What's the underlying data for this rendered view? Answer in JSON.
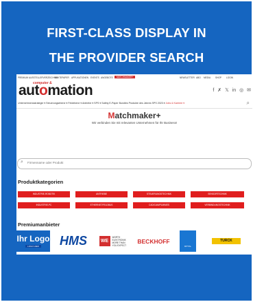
{
  "banner": {
    "headline_line1": "FIRST-CLASS DISPLAY IN",
    "headline_line2": "THE PROVIDER SEARCH",
    "background_color": "#1565c0",
    "text_color": "#ffffff"
  },
  "screenshot": {
    "top_nav": {
      "items": [
        "PREMIUM",
        "AUSSTELLERVERZEICHNIS",
        "WHITEPAPER",
        "APPLIKATIONEN",
        "EVENTS",
        "ANGEBOTE"
      ],
      "highlight_tag": "MATCHMAKER+",
      "right_items": [
        "NEWSLETTER",
        "ABO",
        "MEDIA",
        "SHOP",
        "LOGIN"
      ]
    },
    "logo": {
      "prefix": "computer &",
      "name_part1": "aut",
      "name_accent": "o",
      "name_part2": "mation"
    },
    "social_icons": [
      "facebook-icon",
      "xing-icon",
      "x-icon",
      "linkedin-icon",
      "instagram-icon",
      "mail-icon"
    ],
    "social_glyphs": [
      "f",
      "✗",
      "𝕏",
      "in",
      "◎",
      "✉"
    ],
    "category_nav": {
      "items": [
        "Unternehmensstrategie ▾",
        "Steuerungsebene ▾",
        "Feldebene ▾",
        "Antriebe ▾",
        "SPS ▾",
        "Safety",
        "E-Paper",
        "Bundles",
        "Produkte des Jahres",
        "SPS 2023 ▾"
      ],
      "red_item": "Jobs & Karriere ▾"
    },
    "matchmaker": {
      "title_first": "M",
      "title_rest": "atchmaker+",
      "subtitle": "Wir verbinden Sie mit relevanten Unternehmen für Ihr Business!"
    },
    "search": {
      "placeholder": "Firmenname oder Produkt"
    },
    "categories": {
      "heading": "Produktkategorien",
      "items": [
        "INDUSTRIE-ROBOTIK",
        "ANTRIEBE",
        "STEUERUNGSTECHNIK",
        "SENSORTECHNIK",
        "INDUSTRIE-PC",
        "ETHERNET/FELDBUS",
        "CAD/CAM/PLM/MES",
        "VERBINDUNGSTECHNIK"
      ],
      "color": "#e01e1e"
    },
    "premium": {
      "heading": "Premiumanbieter",
      "ihr_logo": "Ihr Logo",
      "ihr_logo_sub": "LOGO HIER",
      "hms": "HMS",
      "wurth_mark": "WE",
      "wurth_text": "WÜRTH ELEKTRONIK MORE THAN YOU EXPECT",
      "beckhoff": "BECKHOFF",
      "rittal": "RITTAL",
      "turck": "TURCK"
    }
  }
}
